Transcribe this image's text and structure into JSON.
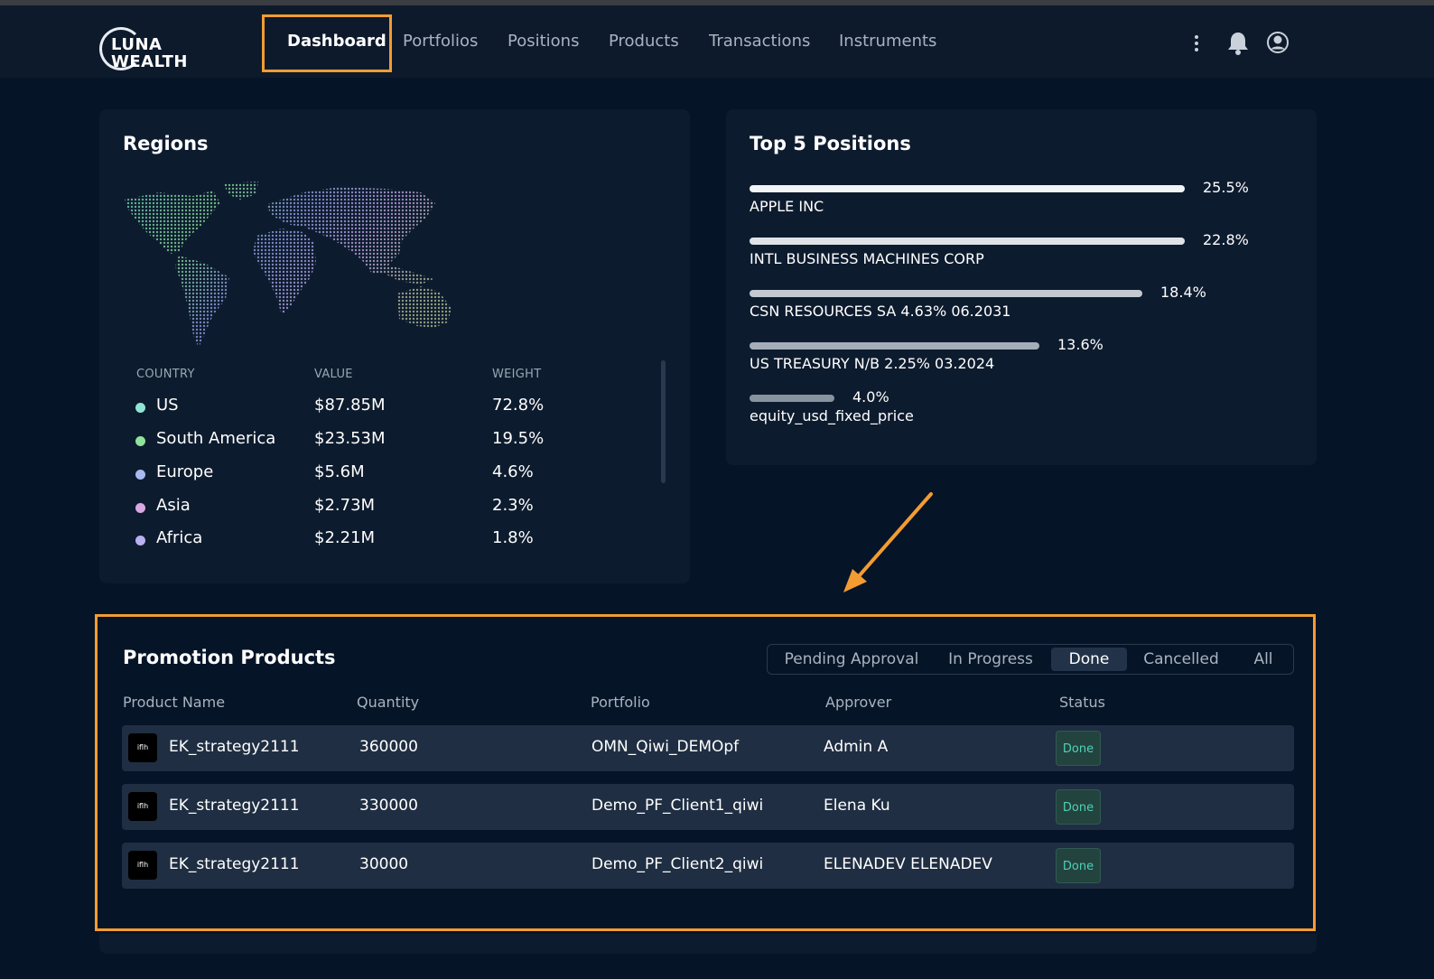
{
  "app": {
    "logo_line1": "LUNA",
    "logo_line2": "WEALTH"
  },
  "nav": {
    "items": [
      {
        "label": "Dashboard",
        "active": true
      },
      {
        "label": "Portfolios"
      },
      {
        "label": "Positions"
      },
      {
        "label": "Products"
      },
      {
        "label": "Transactions"
      },
      {
        "label": "Instruments"
      }
    ],
    "icons": [
      "kebab-menu-icon",
      "bell-icon",
      "user-avatar-icon"
    ]
  },
  "regions": {
    "title": "Regions",
    "headers": {
      "country": "COUNTRY",
      "value": "VALUE",
      "weight": "WEIGHT"
    },
    "rows": [
      {
        "country": "US",
        "value": "$87.85M",
        "weight": "72.8%",
        "color": "#8ee6d2"
      },
      {
        "country": "South America",
        "value": "$23.53M",
        "weight": "19.5%",
        "color": "#8fe39a"
      },
      {
        "country": "Europe",
        "value": "$5.6M",
        "weight": "4.6%",
        "color": "#a9b8ee"
      },
      {
        "country": "Asia",
        "value": "$2.73M",
        "weight": "2.3%",
        "color": "#d9a8e2"
      },
      {
        "country": "Africa",
        "value": "$2.21M",
        "weight": "1.8%",
        "color": "#b9b0f2"
      }
    ]
  },
  "top_positions": {
    "title": "Top 5 Positions",
    "items": [
      {
        "name": "APPLE INC",
        "pct": "25.5%",
        "fraction": 0.255,
        "color": "#f2f4f7"
      },
      {
        "name": "INTL BUSINESS MACHINES CORP",
        "pct": "22.8%",
        "fraction": 0.228,
        "color": "#dfe3e8"
      },
      {
        "name": "CSN RESOURCES SA 4.63% 06.2031",
        "pct": "18.4%",
        "fraction": 0.184,
        "color": "#c3c9d1"
      },
      {
        "name": "US TREASURY N/B 2.25% 03.2024",
        "pct": "13.6%",
        "fraction": 0.136,
        "color": "#a4adb8"
      },
      {
        "name": "equity_usd_fixed_price",
        "pct": "4.0%",
        "fraction": 0.04,
        "color": "#8893a0"
      }
    ]
  },
  "promotion": {
    "title": "Promotion Products",
    "tabs": [
      {
        "label": "Pending Approval"
      },
      {
        "label": "In Progress"
      },
      {
        "label": "Done",
        "active": true
      },
      {
        "label": "Cancelled"
      },
      {
        "label": "All"
      }
    ],
    "columns": {
      "product": "Product Name",
      "quantity": "Quantity",
      "portfolio": "Portfolio",
      "approver": "Approver",
      "status": "Status"
    },
    "rows": [
      {
        "icon_text": "iflh",
        "product": "EK_strategy2111",
        "quantity": "360000",
        "portfolio": "OMN_Qiwi_DEMOpf",
        "approver": "Admin A",
        "status": "Done"
      },
      {
        "icon_text": "iflh",
        "product": "EK_strategy2111",
        "quantity": "330000",
        "portfolio": "Demo_PF_Client1_qiwi",
        "approver": "Elena Ku",
        "status": "Done"
      },
      {
        "icon_text": "iflh",
        "product": "EK_strategy2111",
        "quantity": "30000",
        "portfolio": "Demo_PF_Client2_qiwi",
        "approver": "ELENADEV ELENADEV",
        "status": "Done"
      }
    ]
  },
  "colors": {
    "accent_highlight": "#f39c32",
    "background": "#061427",
    "card": "#0d1b2e",
    "status_done": "#4fd1b5"
  }
}
